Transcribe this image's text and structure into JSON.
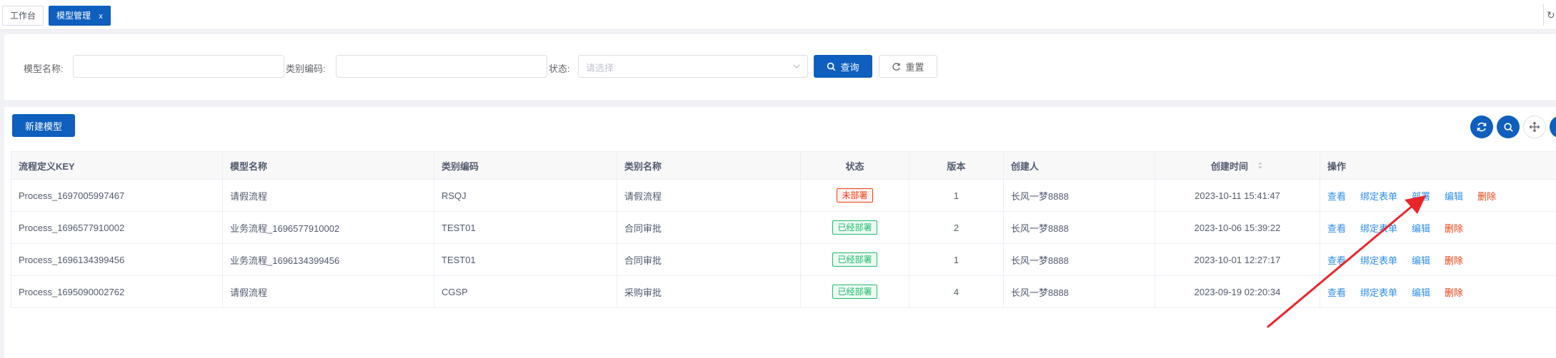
{
  "tabs": [
    {
      "label": "工作台",
      "active": false
    },
    {
      "label": "模型管理",
      "active": true,
      "close": "x"
    }
  ],
  "search": {
    "model_name_label": "模型名称:",
    "model_name_value": "",
    "category_code_label": "类别编码:",
    "category_code_value": "",
    "status_label": "状态:",
    "status_placeholder": "请选择",
    "query_label": "查询",
    "reset_label": "重置"
  },
  "toolbar": {
    "new_model_label": "新建模型"
  },
  "table": {
    "headers": {
      "key": "流程定义KEY",
      "model_name": "模型名称",
      "category_code": "类别编码",
      "category_name": "类别名称",
      "status": "状态",
      "version": "版本",
      "creator": "创建人",
      "created_at": "创建时间",
      "actions": "操作"
    },
    "rows": [
      {
        "key": "Process_1697005997467",
        "model_name": "请假流程",
        "category_code": "RSQJ",
        "category_name": "请假流程",
        "status": "未部署",
        "status_type": "undeployed",
        "version": "1",
        "creator": "长风一梦8888",
        "created_at": "2023-10-11 15:41:47",
        "actions": [
          "查看",
          "绑定表单",
          "部署",
          "编辑",
          "删除"
        ]
      },
      {
        "key": "Process_1696577910002",
        "model_name": "业务流程_1696577910002",
        "category_code": "TEST01",
        "category_name": "合同审批",
        "status": "已经部署",
        "status_type": "deployed",
        "version": "2",
        "creator": "长风一梦8888",
        "created_at": "2023-10-06 15:39:22",
        "actions": [
          "查看",
          "绑定表单",
          "编辑",
          "删除"
        ]
      },
      {
        "key": "Process_1696134399456",
        "model_name": "业务流程_1696134399456",
        "category_code": "TEST01",
        "category_name": "合同审批",
        "status": "已经部署",
        "status_type": "deployed",
        "version": "1",
        "creator": "长风一梦8888",
        "created_at": "2023-10-01 12:27:17",
        "actions": [
          "查看",
          "绑定表单",
          "编辑",
          "删除"
        ]
      },
      {
        "key": "Process_1695090002762",
        "model_name": "请假流程",
        "category_code": "CGSP",
        "category_name": "采购审批",
        "status": "已经部署",
        "status_type": "deployed",
        "version": "4",
        "creator": "长风一梦8888",
        "created_at": "2023-09-19 02:20:34",
        "actions": [
          "查看",
          "绑定表单",
          "编辑",
          "删除"
        ]
      }
    ]
  },
  "icons": [
    "refresh-icon",
    "search-icon",
    "chevron-down-icon",
    "move-icon",
    "sort-icon"
  ],
  "colors": {
    "primary": "#0e5fbe",
    "link": "#2d8cf0",
    "danger": "#ed4014",
    "deployed": "#19be6b",
    "undeployed": "#ed4014",
    "annotation": "#e8262a"
  }
}
